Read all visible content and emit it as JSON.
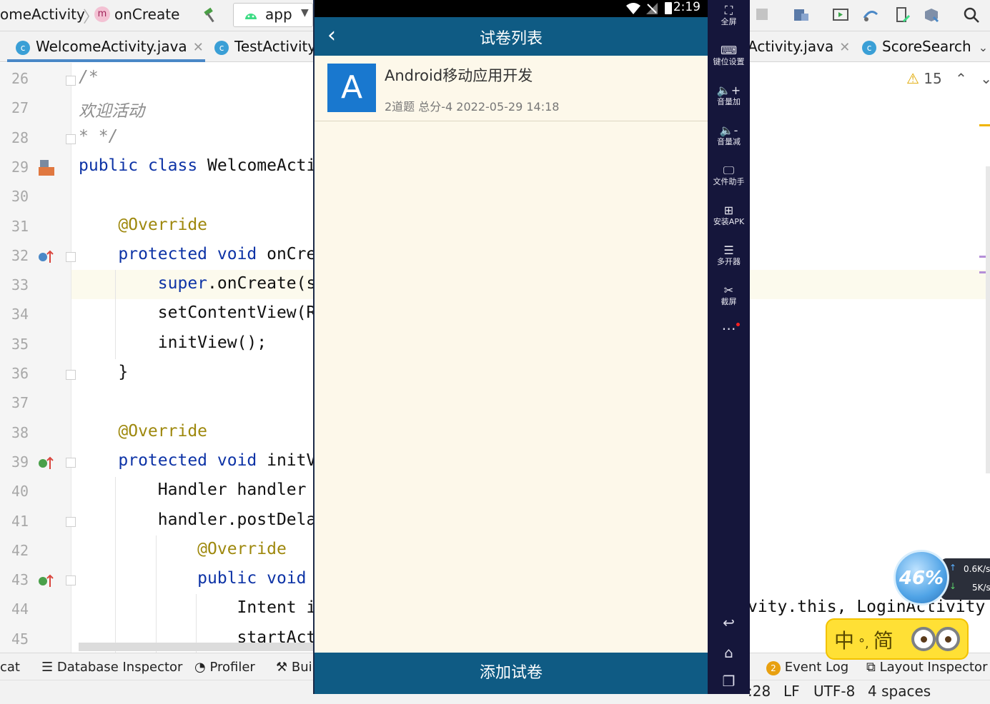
{
  "ide": {
    "breadcrumb": [
      {
        "label": "omeActivity"
      },
      {
        "badge": "m",
        "label": "onCreate"
      }
    ],
    "run_config": {
      "label": "app"
    },
    "tabs": [
      {
        "label": "WelcomeActivity.java",
        "badge": "c",
        "active": true
      },
      {
        "label": "TestActivity",
        "badge": "c",
        "active": false
      },
      {
        "label": "Activity.java",
        "badge": "",
        "active": false
      },
      {
        "label": "ScoreSearch",
        "badge": "c",
        "active": false
      }
    ],
    "warnings": {
      "count": "15"
    },
    "lines": [
      {
        "n": "26",
        "code": "/*"
      },
      {
        "n": "27",
        "code": "欢迎活动"
      },
      {
        "n": "28",
        "code": "* */"
      },
      {
        "n": "29",
        "code": "public class WelcomeActi"
      },
      {
        "n": "30",
        "code": ""
      },
      {
        "n": "31",
        "code": "    @Override"
      },
      {
        "n": "32",
        "code": "    protected void onCre"
      },
      {
        "n": "33",
        "code": "        super.onCreate(s"
      },
      {
        "n": "34",
        "code": "        setContentView(R"
      },
      {
        "n": "35",
        "code": "        initView();"
      },
      {
        "n": "36",
        "code": "    }"
      },
      {
        "n": "37",
        "code": ""
      },
      {
        "n": "38",
        "code": "    @Override"
      },
      {
        "n": "39",
        "code": "    protected void initV"
      },
      {
        "n": "40",
        "code": "        Handler handler "
      },
      {
        "n": "41",
        "code": "        handler.postDela"
      },
      {
        "n": "42",
        "code": "            @Override"
      },
      {
        "n": "43",
        "code": "            public void "
      },
      {
        "n": "44",
        "code": "                Intent i"
      },
      {
        "n": "45",
        "code": "                startAct"
      }
    ],
    "code_tail_44": "vity.this, LoginActivity",
    "bottom_tools": [
      "cat",
      "Database Inspector",
      "Profiler",
      "Bui",
      "Event Log",
      "Layout Inspector"
    ],
    "event_log_badge": "2",
    "status": {
      "position": ":28",
      "line_sep": "LF",
      "encoding": "UTF-8",
      "indent": "4 spaces"
    }
  },
  "emulator": {
    "status_time": "2:19",
    "title": "试卷列表",
    "list": [
      {
        "avatar": "A",
        "name": "Android移动应用开发",
        "meta": "2道题  总分-4  2022-05-29 14:18"
      }
    ],
    "add_button": "添加试卷",
    "side_tools": [
      {
        "icon": "fullscreen-icon",
        "glyph": "⛶",
        "label": "全屏"
      },
      {
        "icon": "keyboard-icon",
        "glyph": "⌨",
        "label": "键位设置"
      },
      {
        "icon": "volume-up-icon",
        "glyph": "🔈+",
        "label": "音量加"
      },
      {
        "icon": "volume-down-icon",
        "glyph": "🔈-",
        "label": "音量减"
      },
      {
        "icon": "file-helper-icon",
        "glyph": "🖵",
        "label": "文件助手"
      },
      {
        "icon": "install-apk-icon",
        "glyph": "⊞",
        "label": "安装APK"
      },
      {
        "icon": "multi-instance-icon",
        "glyph": "☰",
        "label": "多开器"
      },
      {
        "icon": "scissors-icon",
        "glyph": "✂",
        "label": "截屏"
      }
    ]
  },
  "overlay": {
    "monitor_pct": "46%",
    "speed_up": "0.6K/s",
    "speed_down": "5K/s",
    "ime": {
      "lang": "中",
      "mode": "简"
    }
  }
}
